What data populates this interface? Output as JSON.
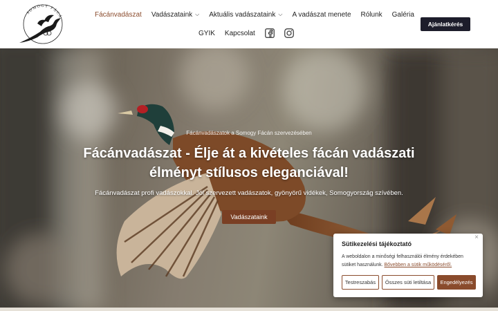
{
  "nav": {
    "items": [
      {
        "label": "Fácánvadászat",
        "active": true
      },
      {
        "label": "Vadászataink",
        "dropdown": true
      },
      {
        "label": "Aktuális vadászataink",
        "dropdown": true
      },
      {
        "label": "A vadászat menete"
      },
      {
        "label": "Rólunk"
      },
      {
        "label": "Galéria"
      }
    ],
    "items_row2": [
      {
        "label": "GYIK"
      },
      {
        "label": "Kapcsolat"
      }
    ],
    "social": [
      "facebook-icon",
      "instagram-icon"
    ],
    "cta_label": "Ajánlatkérés"
  },
  "logo": {
    "text": "SOMOGY FÁCÁN"
  },
  "hero": {
    "eyebrow": "Fácánvadászatok a Somogy Fácán szervezésében",
    "title": "Fácánvadászat - Élje át a kivételes fácán vadászati élményt stílusos eleganciával!",
    "subtitle": "Fácánvadászat profi vadászokkal. Jól szervezett vadászatok, gyönyörű vidékek, Somogyország szívében.",
    "button_label": "Vadászataink"
  },
  "cookie": {
    "title": "Sütikezelési tájékoztató",
    "text": "A weboldalon a minőségi felhasználói élmény érdekében sütiket használunk.",
    "link_label": "Bővebben a sütik működéséről.",
    "buttons": {
      "test": "Testreszabás",
      "reject": "Összes süti letiltása",
      "accept": "Engedélyezés"
    },
    "close": "×"
  },
  "colors": {
    "accent": "#8a4b2c",
    "cta_bg": "#1d1d2b",
    "hero_button": "#7a3f24"
  }
}
